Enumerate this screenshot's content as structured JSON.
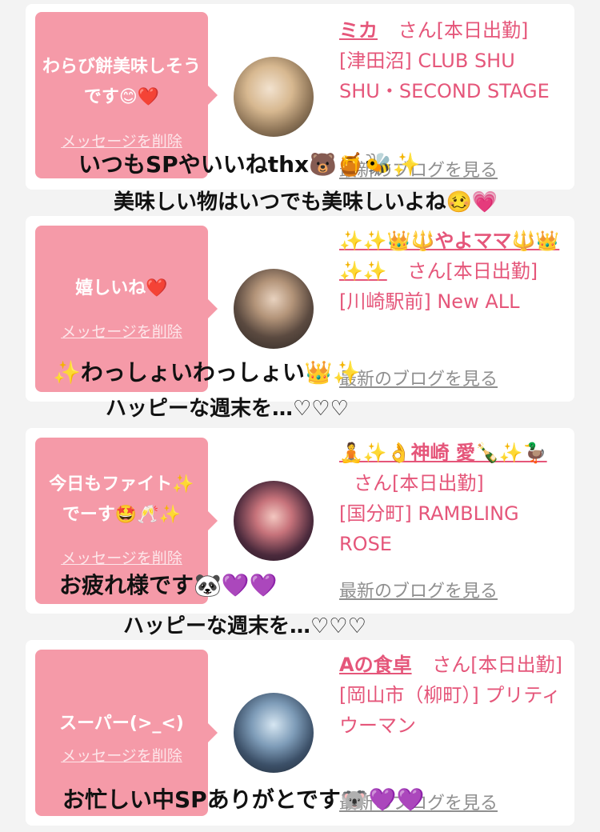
{
  "cards": [
    {
      "message": "わらび餅美味しそうです😊❤️",
      "delete_label": "メッセージを削除",
      "name": "ミカ",
      "san": "さん[本日出勤]",
      "shop": "[津田沼] CLUB SHU SHU・SECOND STAGE",
      "blog_label": "最新のブログを見る",
      "avatar": "blonde-woman-photo"
    },
    {
      "message": "嬉しいね❤️",
      "delete_label": "メッセージを削除",
      "name": "✨✨👑🔱やよママ🔱👑✨✨",
      "san": "さん[本日出勤]",
      "shop": "[川崎駅前] New ALL",
      "blog_label": "最新のブログを見る",
      "avatar": "masked-person-photo"
    },
    {
      "message": "今日もファイト✨でーす🤩🥂✨",
      "delete_label": "メッセージを削除",
      "name": "🧘✨👌神崎 愛🍾✨🦆",
      "san": "さん[本日出勤]",
      "shop": "[国分町] RAMBLING ROSE",
      "blog_label": "最新のブログを見る",
      "avatar": "woman-night-photo"
    },
    {
      "message": "スーパー(>_<)",
      "delete_label": "メッセージを削除",
      "name": "Aの食卓",
      "san": "さん[本日出勤]",
      "shop": "[岡山市（柳町）] プリティウーマン",
      "blog_label": "最新のブログを見る",
      "avatar": "blue-abstract-photo"
    }
  ],
  "overlays": [
    "いつもSPやいいねthx🐻🍯🐝✨",
    "美味しい物はいつでも美味しいよね🥴💗",
    "✨わっしょいわっしょい👑✨",
    "ハッピーな週末を…♡♡♡",
    "お疲れ様です🐼💜💜",
    "ハッピーな週末を…♡♡♡",
    "お忙しい中SPありがとです🐨💜💜"
  ],
  "colors": {
    "bubble": "#f59aa8",
    "accent": "#e5567a",
    "background": "#f3f3f3"
  }
}
